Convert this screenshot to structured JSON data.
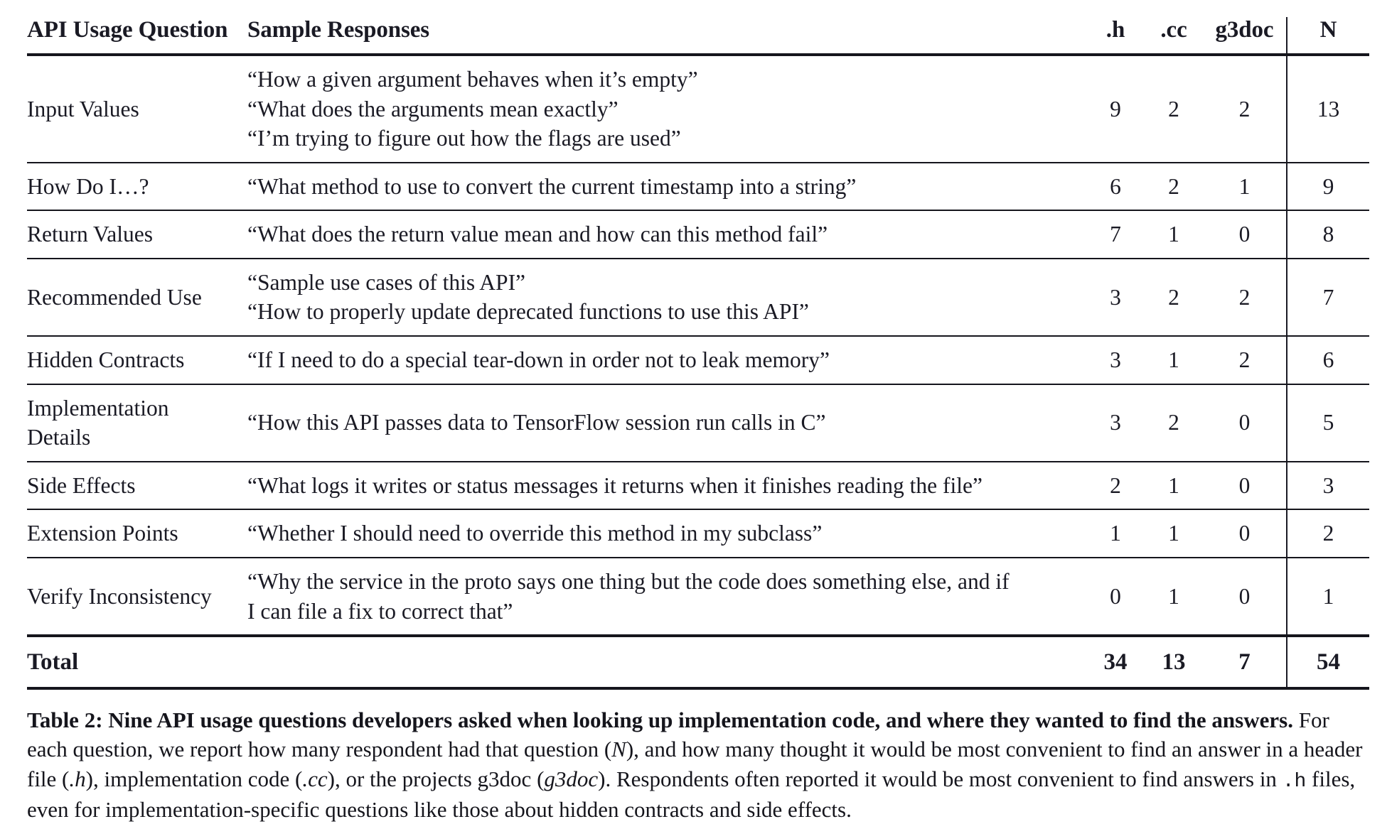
{
  "table": {
    "columns": [
      {
        "key": "question",
        "label": "API Usage Question"
      },
      {
        "key": "sample",
        "label": "Sample Responses"
      },
      {
        "key": "h",
        "label": ".h"
      },
      {
        "key": "cc",
        "label": ".cc"
      },
      {
        "key": "g3doc",
        "label": "g3doc"
      },
      {
        "key": "n",
        "label": "N"
      }
    ],
    "rows": [
      {
        "question": "Input Values",
        "responses": [
          "“How a given argument behaves when it’s empty”",
          "“What does the arguments mean exactly”",
          "“I’m trying to figure out how the flags are used”"
        ],
        "h": "9",
        "cc": "2",
        "g3doc": "2",
        "n": "13"
      },
      {
        "question": "How Do I…?",
        "responses": [
          "“What method to use to convert the current timestamp into a string”"
        ],
        "h": "6",
        "cc": "2",
        "g3doc": "1",
        "n": "9"
      },
      {
        "question": "Return Values",
        "responses": [
          "“What does the return value mean and how can this method fail”"
        ],
        "h": "7",
        "cc": "1",
        "g3doc": "0",
        "n": "8"
      },
      {
        "question": "Recommended Use",
        "responses": [
          "“Sample use cases of this API”",
          "“How to properly update deprecated functions to use this API”"
        ],
        "h": "3",
        "cc": "2",
        "g3doc": "2",
        "n": "7"
      },
      {
        "question": "Hidden Contracts",
        "responses": [
          "“If I need to do a special tear-down in order not to leak memory”"
        ],
        "h": "3",
        "cc": "1",
        "g3doc": "2",
        "n": "6"
      },
      {
        "question": "Implementation Details",
        "responses": [
          "“How this API passes data to TensorFlow session run calls in C”"
        ],
        "h": "3",
        "cc": "2",
        "g3doc": "0",
        "n": "5"
      },
      {
        "question": "Side Effects",
        "responses": [
          "“What logs it writes or status messages it returns when it finishes reading the file”"
        ],
        "h": "2",
        "cc": "1",
        "g3doc": "0",
        "n": "3"
      },
      {
        "question": "Extension Points",
        "responses": [
          "“Whether I should need to override this method in my subclass”"
        ],
        "h": "1",
        "cc": "1",
        "g3doc": "0",
        "n": "2"
      },
      {
        "question": "Verify Inconsistency",
        "responses": [
          "“Why the service in the proto says one thing but the code does something else, and if",
          "I can file a fix to correct that”"
        ],
        "h": "0",
        "cc": "1",
        "g3doc": "0",
        "n": "1"
      }
    ],
    "total": {
      "label": "Total",
      "h": "34",
      "cc": "13",
      "g3doc": "7",
      "n": "54"
    }
  },
  "caption": {
    "bold_lead": "Table 2: Nine API usage questions developers asked when looking up implementation code, and where they wanted to find the answers.",
    "body_1": " For each question, we report how many respondent had that question (",
    "italic_n": "N",
    "body_2": "), and how many thought it would be most convenient to find an answer in a header file (",
    "italic_h": ".h",
    "body_3": "), implementation code (",
    "italic_cc": ".cc",
    "body_4": "), or the projects g3doc (",
    "italic_g3doc": "g3doc",
    "body_5": "). Respondents often reported it would be most convenient to find answers in ",
    "mono_h": ".h",
    "body_6": " files, even for implementation-specific questions like those about hidden contracts and side effects."
  }
}
